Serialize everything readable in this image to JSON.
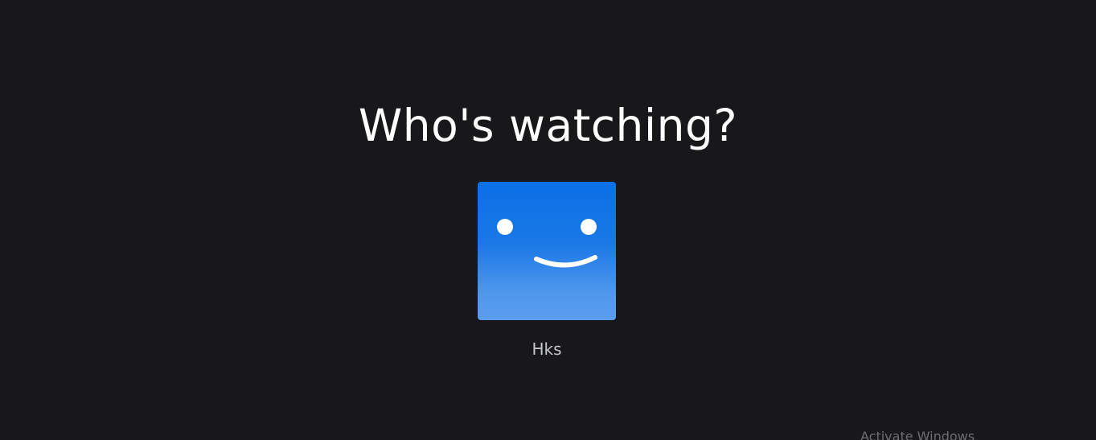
{
  "heading": "Who's watching?",
  "profiles": [
    {
      "name": "Hks",
      "avatar_icon": "smiley-face-icon",
      "avatar_colors": {
        "top": "#0a70e6",
        "bottom": "#5a9df0",
        "face": "#ffffff"
      }
    }
  ],
  "watermark": {
    "text": "Activate Windows"
  },
  "colors": {
    "background": "#18181a",
    "heading": "#ffffff",
    "profile_name": "#c3c6cb"
  }
}
